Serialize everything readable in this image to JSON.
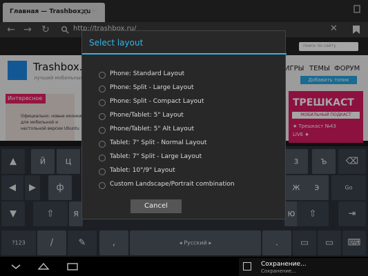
{
  "browser": {
    "tab_title": "Главная — Trashbox.ru",
    "tab_close_icon": "close-icon",
    "new_tab_icon": "plus-icon",
    "url": "http://trashbox.ru/",
    "url_clear_icon": "close-icon"
  },
  "page": {
    "search_placeholder": "поиск по сайту",
    "site_name": "Trashbox.ru",
    "site_tagline": "лучший мобильный",
    "menu": [
      "ИГРЫ",
      "ТЕМЫ",
      "ФОРУМ"
    ],
    "add_topic": "Добавить топик",
    "featured_tag": "Интересное",
    "featured_text": "Официально: новые иконки для мобильной и настольной версии Ubuntu",
    "podcast_title": "ТРЕШКАСТ",
    "podcast_sub": "МОБИЛЬНЫЙ ПОДКАСТ",
    "podcast_episode": "★ Трешкаст №43",
    "podcast_live": "LIVE ★"
  },
  "dialog": {
    "title": "Select layout",
    "options": [
      "Phone: Standard Layout",
      "Phone: Split - Large Layout",
      "Phone: Split - Compact Layout",
      "Phone/Tablet: 5\" Layout",
      "Phone/Tablet: 5\" Alt Layout",
      "Tablet: 7\" Split - Normal Layout",
      "Tablet: 7\" Split - Large Layout",
      "Tablet: 10\"/9\" Layout",
      "Custom Landscape/Portrait combination"
    ],
    "cancel_label": "Cancel"
  },
  "keyboard": {
    "row1_left": "й",
    "row1_left2": "ц",
    "row1_right": "з",
    "row1_right2": "ъ",
    "row2_left": "ф",
    "row2_right": "ж",
    "row2_right2": "э",
    "go": "Go",
    "row3_mid": "я",
    "row3_right": "ю",
    "num_key": "?123",
    "slash": "/",
    "comma": ",",
    "space_label": "◂ Русский ▸",
    "period": ".",
    "colon_hint": ":"
  },
  "notification": {
    "title": "Сохранение...",
    "subtitle": "Сохранение..."
  },
  "colors": {
    "accent": "#33b5e5",
    "brand_pink": "#d81b60",
    "site_blue": "#1e88e5"
  }
}
